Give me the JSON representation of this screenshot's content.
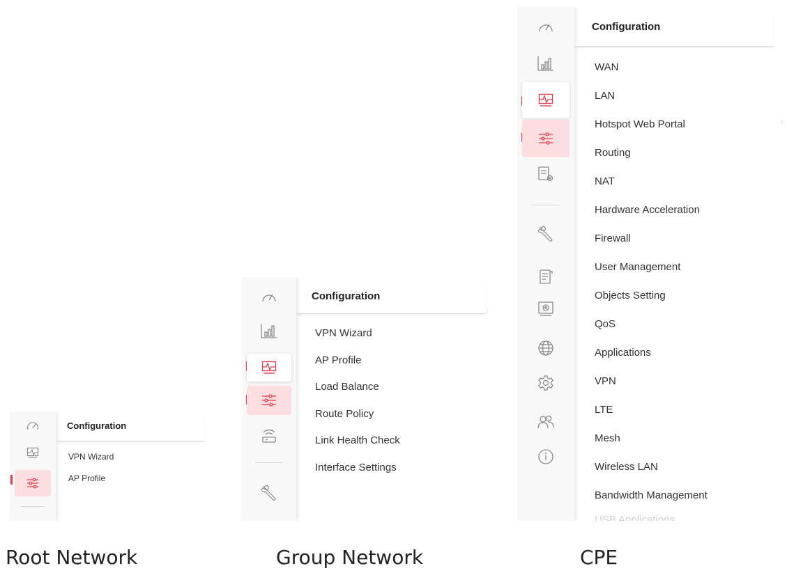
{
  "colors": {
    "accent": "#e63b4a",
    "selected_pink_bg": "#fcdde0",
    "rail_bg": "#f8f8f8",
    "icon_gray": "#8a8a8a"
  },
  "captions": {
    "root": "Root Network",
    "group": "Group Network",
    "cpe": "CPE"
  },
  "root_panel": {
    "menu": {
      "header": "Configuration",
      "items": [
        "VPN Wizard",
        "AP Profile"
      ]
    },
    "rail_icons": [
      "dashboard-icon",
      "monitoring-icon",
      "configuration-icon"
    ]
  },
  "group_panel": {
    "menu": {
      "header": "Configuration",
      "items": [
        "VPN Wizard",
        "AP Profile",
        "Load Balance",
        "Route Policy",
        "Link Health Check",
        "Interface Settings"
      ]
    },
    "rail_icons": [
      "dashboard-icon",
      "statistics-icon",
      "monitoring-icon",
      "configuration-icon",
      "router-icon",
      "wrench-icon"
    ]
  },
  "cpe_panel": {
    "menu": {
      "header": "Configuration",
      "items": [
        "WAN",
        "LAN",
        "Hotspot Web Portal",
        "Routing",
        "NAT",
        "Hardware Acceleration",
        "Firewall",
        "User Management",
        "Objects Setting",
        "QoS",
        "Applications",
        "VPN",
        "LTE",
        "Mesh",
        "Wireless LAN",
        "Bandwidth Management",
        "USB Applications"
      ]
    },
    "rail_icons": [
      "dashboard-icon",
      "statistics-icon",
      "monitoring-icon",
      "configuration-icon",
      "report-icon",
      "wrench-icon",
      "log-icon",
      "diagnostics-icon",
      "globe-icon",
      "gear-icon",
      "users-icon",
      "info-icon"
    ]
  }
}
